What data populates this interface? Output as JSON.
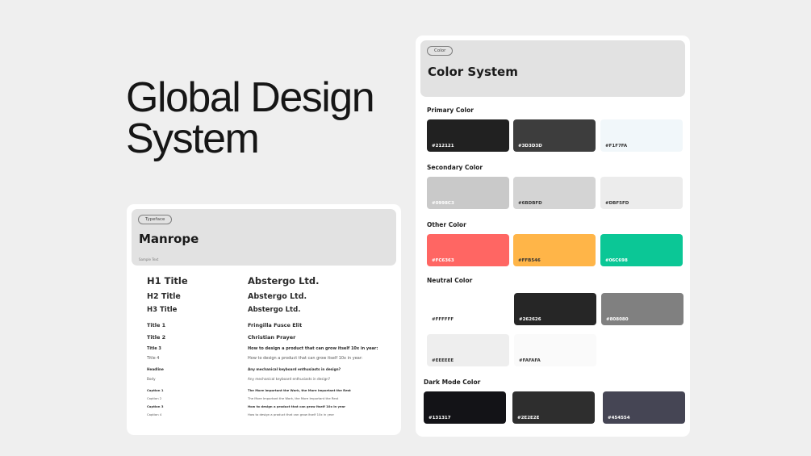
{
  "hero": {
    "title": "Global Design\nSystem"
  },
  "typography": {
    "tag": "Typeface",
    "font_family": "Manrope",
    "sample_caption": "Sample Text",
    "rows": [
      {
        "label": "H1 Title",
        "sample": "Abstergo Ltd."
      },
      {
        "label": "H2 Title",
        "sample": "Abstergo Ltd."
      },
      {
        "label": "H3 Title",
        "sample": "Abstergo Ltd."
      },
      {
        "label": "Title 1",
        "sample": "Fringilla Fusce Elit"
      },
      {
        "label": "Title 2",
        "sample": "Christian Prayer"
      },
      {
        "label": "Title 3",
        "sample": "How to design a product that can grow itself 10x in year:"
      },
      {
        "label": "Title 4",
        "sample": "How to design a product that can grow itself 10x in year:"
      },
      {
        "label": "Headline",
        "sample": "Any mechanical keyboard enthusiasts in design?"
      },
      {
        "label": "Body",
        "sample": "Any mechanical keyboard enthusiasts in design?"
      },
      {
        "label": "Caption 1",
        "sample": "The More Important the Work, the More Important the Rest"
      },
      {
        "label": "Caption 2",
        "sample": "The More Important the Work, the More Important the Rest"
      },
      {
        "label": "Caption 3",
        "sample": "How to design a product that can grow itself 10x in year"
      },
      {
        "label": "Caption 4",
        "sample": "How to design a product that can grow itself 10x in year"
      }
    ]
  },
  "colors": {
    "tag": "Color",
    "title": "Color System",
    "sections": {
      "primary": {
        "label": "Primary Color",
        "swatches": [
          {
            "hex": "#212121",
            "text": "#ffffff"
          },
          {
            "hex": "#3D3D3D",
            "text": "#ffffff"
          },
          {
            "hex": "#F1F7FA",
            "text": "#333333"
          }
        ]
      },
      "secondary": {
        "label": "Secondary Color",
        "swatches": [
          {
            "hex": "#C9C9C9",
            "label": "#0998C3",
            "text": "#ffffff"
          },
          {
            "hex": "#D4D4D4",
            "label": "#6BDBFD",
            "text": "#333333"
          },
          {
            "hex": "#ECECEC",
            "label": "#DBF5FD",
            "text": "#333333"
          }
        ]
      },
      "other": {
        "label": "Other Color",
        "swatches": [
          {
            "hex": "#FF6663",
            "label": "#FC6363",
            "text": "#ffffff"
          },
          {
            "hex": "#FFB548",
            "label": "#FFB546",
            "text": "#333333"
          },
          {
            "hex": "#0BC796",
            "label": "#06C698",
            "text": "#ffffff"
          }
        ]
      },
      "neutral": {
        "label": "Neutral Color",
        "swatches": [
          {
            "hex": "#FFFFFF",
            "text": "#333333"
          },
          {
            "hex": "#262626",
            "text": "#ffffff"
          },
          {
            "hex": "#808080",
            "text": "#ffffff"
          },
          {
            "hex": "#EEEEEE",
            "text": "#333333"
          },
          {
            "hex": "#FAFAFA",
            "text": "#333333"
          }
        ]
      },
      "dark": {
        "label": "Dark Mode Color",
        "swatches": [
          {
            "hex": "#131317",
            "text": "#ffffff"
          },
          {
            "hex": "#2E2E2E",
            "text": "#ffffff"
          },
          {
            "hex": "#454554",
            "text": "#ffffff"
          }
        ]
      }
    }
  }
}
